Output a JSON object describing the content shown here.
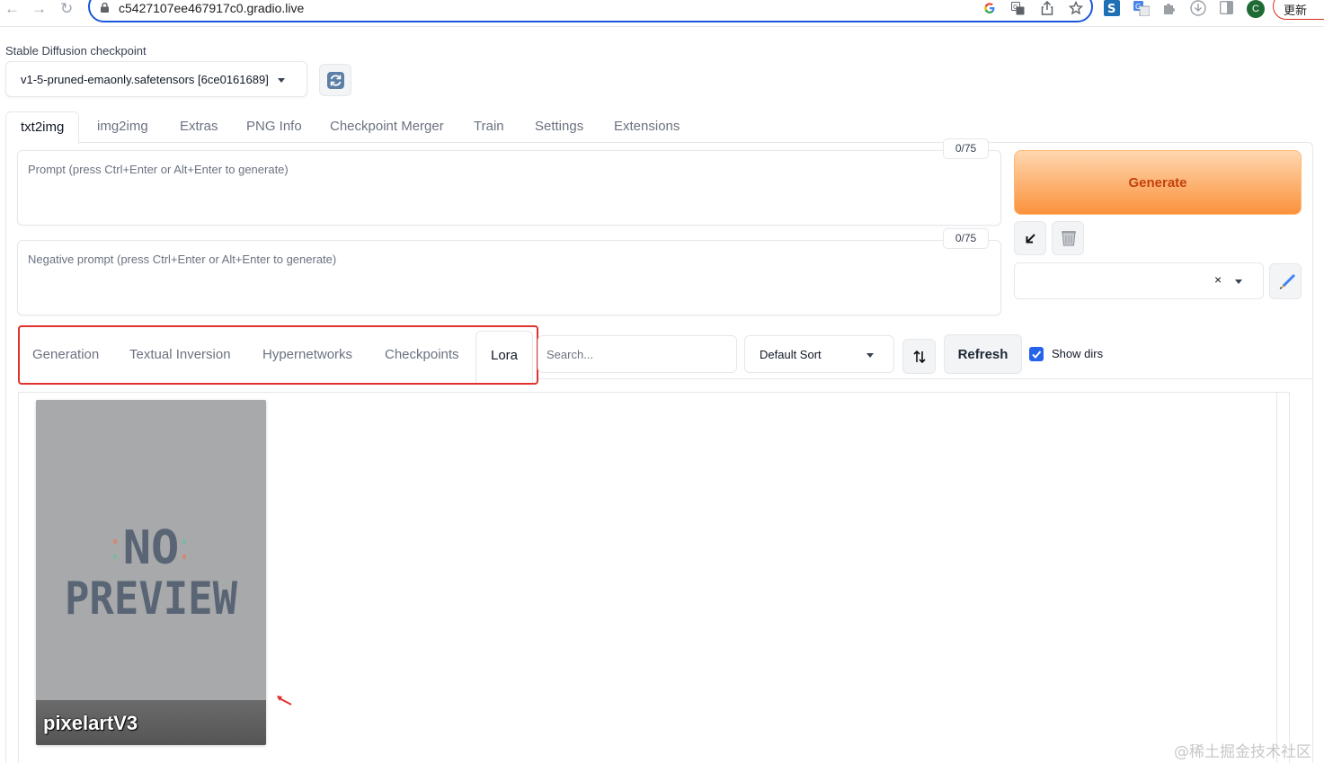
{
  "browser": {
    "url": "c5427107ee467917c0.gradio.live",
    "back_glyph": "←",
    "forward_glyph": "→",
    "reload_glyph": "↻",
    "profile_initial": "C",
    "update_label": "更新"
  },
  "checkpoint": {
    "label": "Stable Diffusion checkpoint",
    "value": "v1-5-pruned-emaonly.safetensors [6ce0161689]"
  },
  "main_tabs": [
    "txt2img",
    "img2img",
    "Extras",
    "PNG Info",
    "Checkpoint Merger",
    "Train",
    "Settings",
    "Extensions"
  ],
  "prompt": {
    "placeholder": "Prompt (press Ctrl+Enter or Alt+Enter to generate)",
    "token_count": "0/75"
  },
  "negative_prompt": {
    "placeholder": "Negative prompt (press Ctrl+Enter or Alt+Enter to generate)",
    "token_count": "0/75"
  },
  "generate": {
    "label": "Generate"
  },
  "style_select": {
    "clear_glyph": "×"
  },
  "extra_networks": {
    "tabs": [
      "Generation",
      "Textual Inversion",
      "Hypernetworks",
      "Checkpoints",
      "Lora"
    ],
    "active_tab": "Lora",
    "search_placeholder": "Search...",
    "sort_value": "Default Sort",
    "refresh_label": "Refresh",
    "show_dirs_label": "Show dirs",
    "show_dirs_checked": true
  },
  "card": {
    "preview_line1": "NO",
    "preview_line2": "PREVIEW",
    "name": "pixelartV3"
  },
  "watermark": "@稀土掘金技术社区",
  "colors": {
    "accent": "#2563eb",
    "highlight_border": "#e0322e",
    "generate_text": "#c2410c"
  }
}
